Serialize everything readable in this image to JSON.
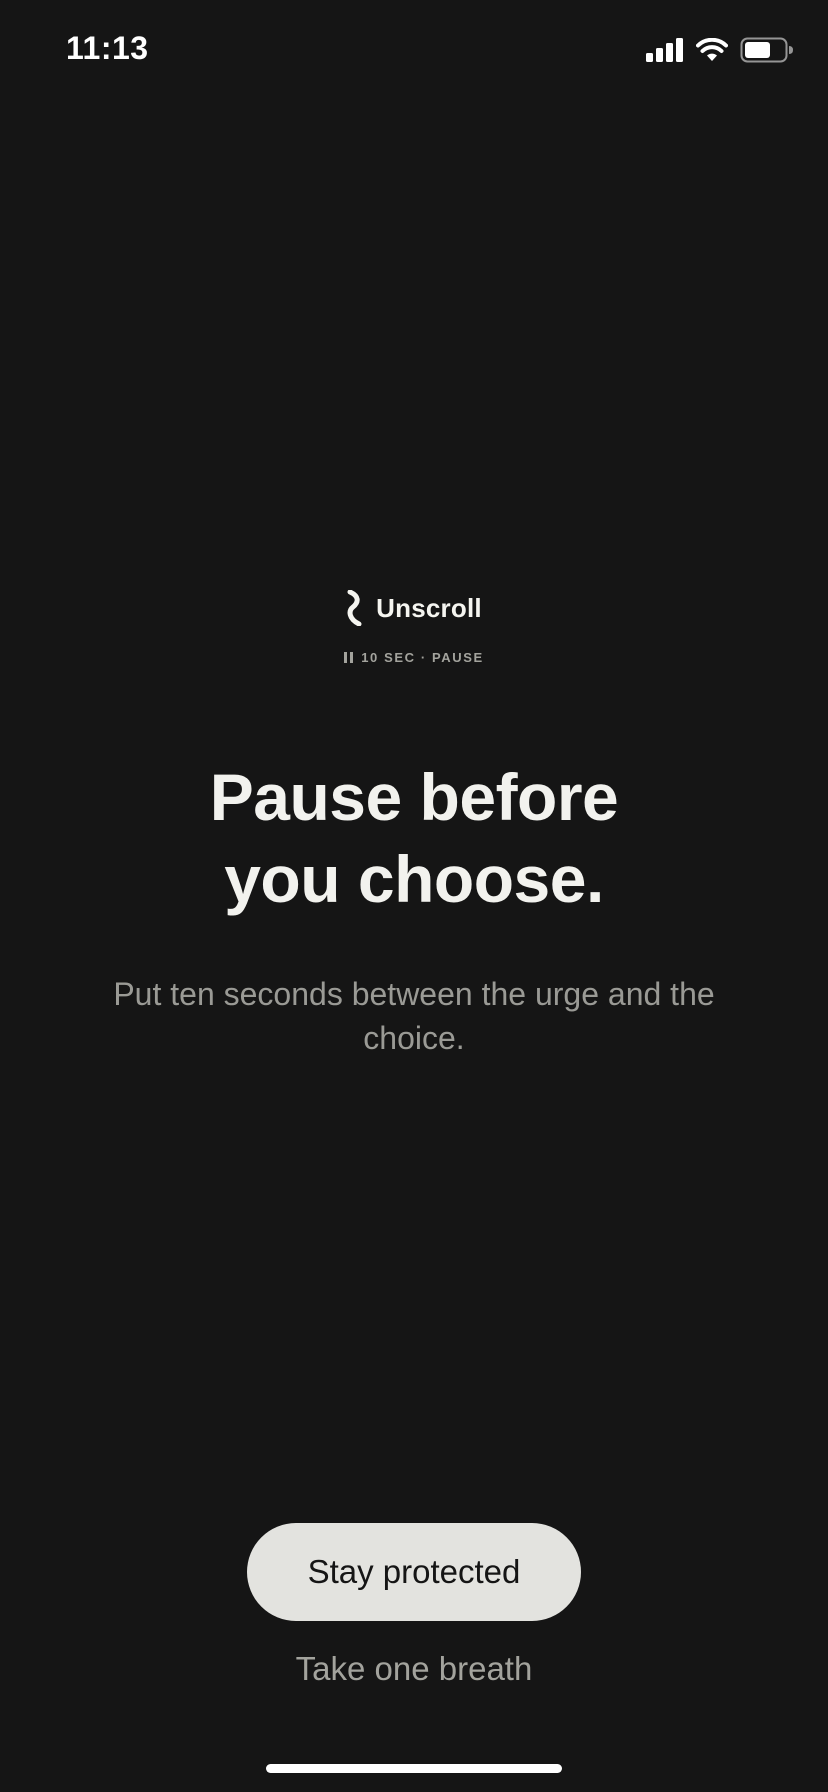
{
  "status_bar": {
    "time": "11:13",
    "icons": [
      "cellular-signal-icon",
      "wifi-icon",
      "battery-icon"
    ]
  },
  "brand": {
    "name": "Unscroll",
    "logo_icon": "unscroll-logo-icon"
  },
  "pause_tag": {
    "icon": "pause-icon",
    "label": "10 SEC · PAUSE"
  },
  "headline": {
    "line1": "Pause before",
    "line2": "you choose."
  },
  "subtitle": "Put ten seconds between the urge and the choice.",
  "actions": {
    "primary_label": "Stay protected",
    "secondary_label": "Take one breath"
  },
  "colors": {
    "background": "#151515",
    "text_primary": "#f2f2ee",
    "text_secondary": "#9a9a95",
    "button_fill": "#e3e3df",
    "button_text": "#151515"
  }
}
